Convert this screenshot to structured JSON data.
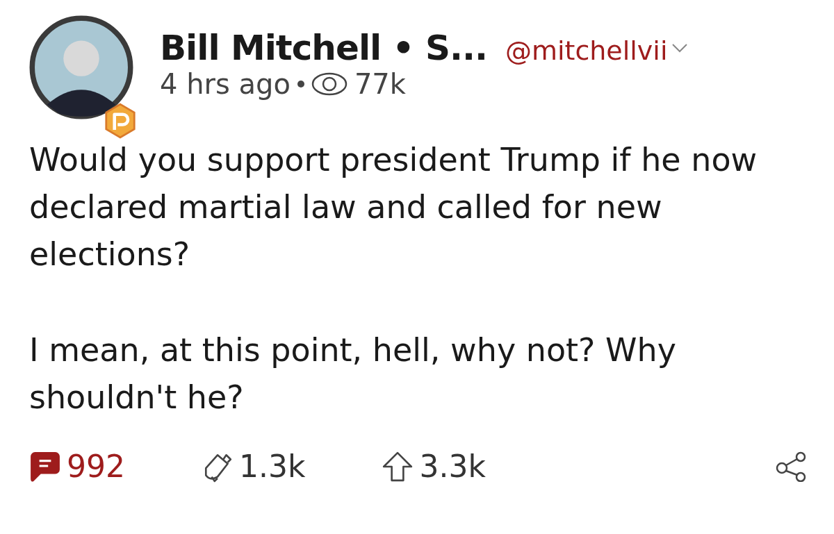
{
  "post": {
    "author": "Bill Mitchell • S...",
    "handle": "@mitchellvii",
    "time": "4 hrs ago",
    "views": "77k",
    "paragraphs": [
      "Would you support president Trump if he now declared martial law and called for new elections?",
      "I mean, at this point, hell, why not? Why shouldn't he?"
    ],
    "actions": [
      {
        "kind": "comment",
        "count": "992"
      },
      {
        "kind": "echo",
        "count": "1.3k"
      },
      {
        "kind": "upvote",
        "count": "3.3k"
      },
      {
        "kind": "share"
      }
    ]
  }
}
